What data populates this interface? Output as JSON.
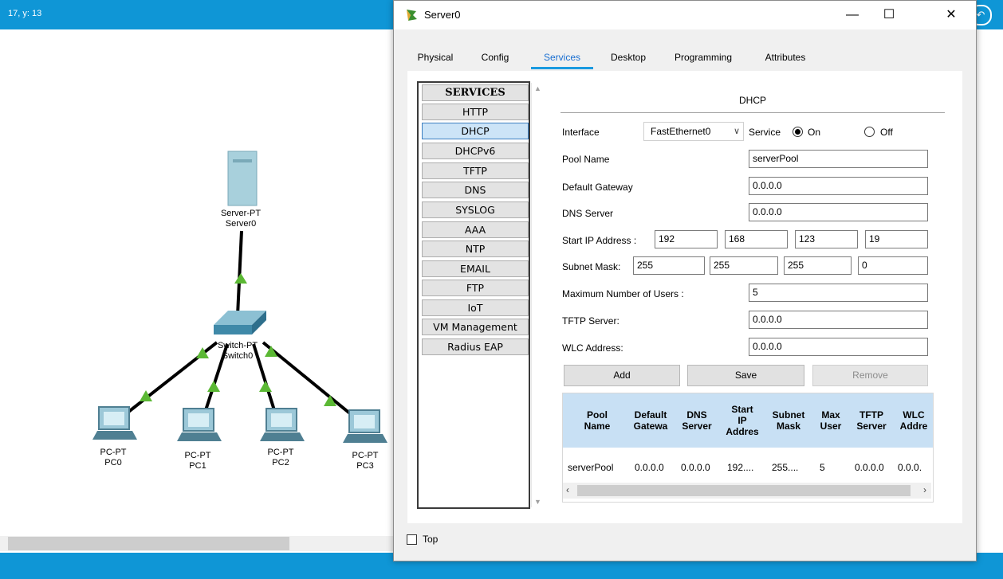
{
  "workspace": {
    "coordinate_text": "17, y: 13",
    "devices": [
      {
        "type": "Server-PT",
        "name": "Server0"
      },
      {
        "type": "Switch-PT",
        "name": "Switch0"
      },
      {
        "type": "PC-PT",
        "name": "PC0"
      },
      {
        "type": "PC-PT",
        "name": "PC1"
      },
      {
        "type": "PC-PT",
        "name": "PC2"
      },
      {
        "type": "PC-PT",
        "name": "PC3"
      }
    ],
    "link_color": "#000000",
    "link_up_color": "#5bb834"
  },
  "window": {
    "title": "Server0",
    "minimize": "—",
    "maximize": "☐",
    "close": "✕"
  },
  "tabs": [
    "Physical",
    "Config",
    "Services",
    "Desktop",
    "Programming",
    "Attributes"
  ],
  "active_tab": "Services",
  "services": {
    "header": "SERVICES",
    "items": [
      "HTTP",
      "DHCP",
      "DHCPv6",
      "TFTP",
      "DNS",
      "SYSLOG",
      "AAA",
      "NTP",
      "EMAIL",
      "FTP",
      "IoT",
      "VM Management",
      "Radius EAP"
    ],
    "selected": "DHCP"
  },
  "dhcp": {
    "title": "DHCP",
    "interface_label": "Interface",
    "interface_value": "FastEthernet0",
    "service_label": "Service",
    "on_label": "On",
    "off_label": "Off",
    "service_state": "On",
    "pool_name_label": "Pool Name",
    "pool_name": "serverPool",
    "default_gateway_label": "Default Gateway",
    "default_gateway": "0.0.0.0",
    "dns_server_label": "DNS Server",
    "dns_server": "0.0.0.0",
    "start_ip_label": "Start IP Address :",
    "start_ip": [
      "192",
      "168",
      "123",
      "19"
    ],
    "subnet_mask_label": "Subnet Mask:",
    "subnet_mask": [
      "255",
      "255",
      "255",
      "0"
    ],
    "max_users_label": "Maximum Number of Users :",
    "max_users": "5",
    "tftp_server_label": "TFTP Server:",
    "tftp_server": "0.0.0.0",
    "wlc_address_label": "WLC Address:",
    "wlc_address": "0.0.0.0",
    "add_button": "Add",
    "save_button": "Save",
    "remove_button": "Remove"
  },
  "pool_table": {
    "headers": [
      "Pool\nName",
      "Default\nGatewa",
      "DNS\nServer",
      "Start\nIP\nAddres",
      "Subnet\nMask",
      "Max\nUser",
      "TFTP\nServer",
      "WLC\nAddre"
    ],
    "rows": [
      [
        "serverPool",
        "0.0.0.0",
        "0.0.0.0",
        "192....",
        "255....",
        "5",
        "0.0.0.0",
        "0.0.0."
      ]
    ]
  },
  "footer": {
    "top_label": "Top"
  },
  "colors": {
    "accent": "#0f96d6",
    "tab_active": "#1a6fd1",
    "selected_item": "#cce4f7",
    "table_header": "#c8e0f4"
  }
}
